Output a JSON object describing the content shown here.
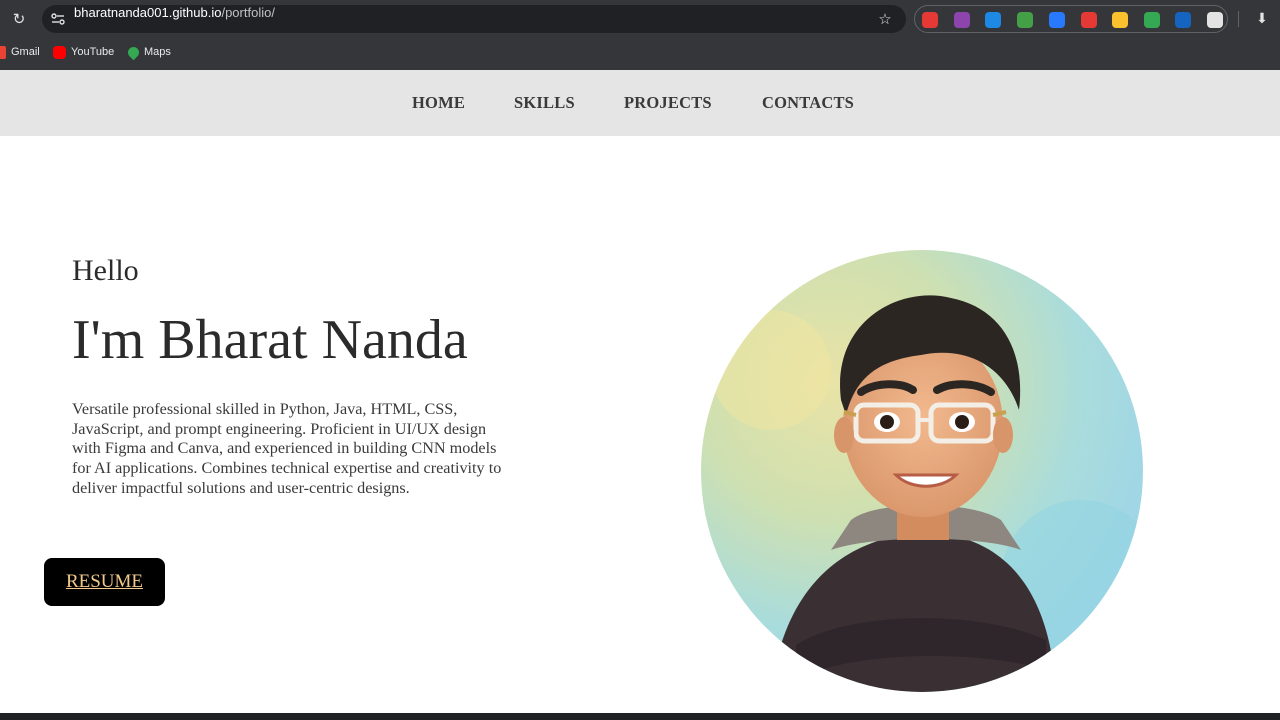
{
  "browser": {
    "url_host": "bharatnanda001.github.io",
    "url_path": "/portfolio/",
    "bookmarks": [
      {
        "label": "Gmail",
        "icon": "gmail-icon",
        "color": "#ea4335"
      },
      {
        "label": "YouTube",
        "icon": "youtube-icon",
        "color": "#ff0000"
      },
      {
        "label": "Maps",
        "icon": "maps-icon",
        "color": "#34a853"
      }
    ],
    "extensions": [
      {
        "icon": "pokeball-icon",
        "color": "#e53935"
      },
      {
        "icon": "purple-ext-icon",
        "color": "#8e44ad"
      },
      {
        "icon": "blue-dark-ext-icon",
        "color": "#1e88e5"
      },
      {
        "icon": "green-ext-icon",
        "color": "#43a047"
      },
      {
        "icon": "blue-wave-ext-icon",
        "color": "#2979ff"
      },
      {
        "icon": "red-play-ext-icon",
        "color": "#e53935"
      },
      {
        "icon": "hand-ext-icon",
        "color": "#fbc02d"
      },
      {
        "icon": "drive-icon",
        "color": "#34a853"
      },
      {
        "icon": "blue-badge-ext-icon",
        "color": "#1565c0"
      },
      {
        "icon": "puzzle-icon",
        "color": "#e3e3e3"
      }
    ]
  },
  "nav": {
    "items": [
      {
        "label": "HOME"
      },
      {
        "label": "SKILLS"
      },
      {
        "label": "PROJECTS"
      },
      {
        "label": "CONTACTS"
      }
    ]
  },
  "hero": {
    "greeting": "Hello",
    "name": "I'm Bharat Nanda",
    "bio": "Versatile professional skilled in Python, Java, HTML, CSS, JavaScript, and prompt engineering. Proficient in UI/UX design with Figma and Canva, and experienced in building CNN models for AI applications. Combines technical expertise and creativity to deliver impactful solutions and user-centric designs.",
    "resume_label": "RESUME"
  },
  "colors": {
    "nav_bg": "#e5e5e5",
    "resume_bg": "#000000",
    "resume_text": "#f3c98b",
    "chrome_bg": "#35363a"
  }
}
